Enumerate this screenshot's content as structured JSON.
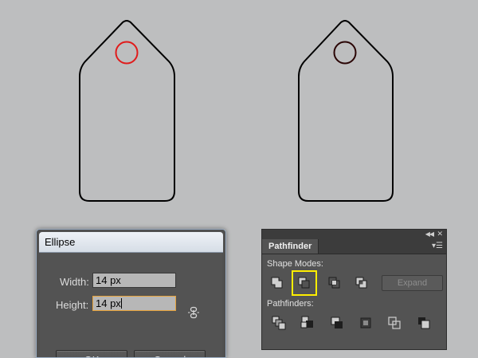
{
  "ellipse_dialog": {
    "title": "Ellipse",
    "width_label": "Width:",
    "width_value": "14 px",
    "height_label": "Height:",
    "height_value": "14 px",
    "ok_label": "OK",
    "cancel_label": "Cancel"
  },
  "pathfinder_panel": {
    "tab_label": "Pathfinder",
    "shape_modes_label": "Shape Modes:",
    "pathfinders_label": "Pathfinders:",
    "expand_label": "Expand"
  },
  "colors": {
    "canvas_bg": "#bdbebf",
    "selected_circle": "#e01b1b",
    "highlight": "#ffee00",
    "focus_border": "#e6a33c"
  }
}
